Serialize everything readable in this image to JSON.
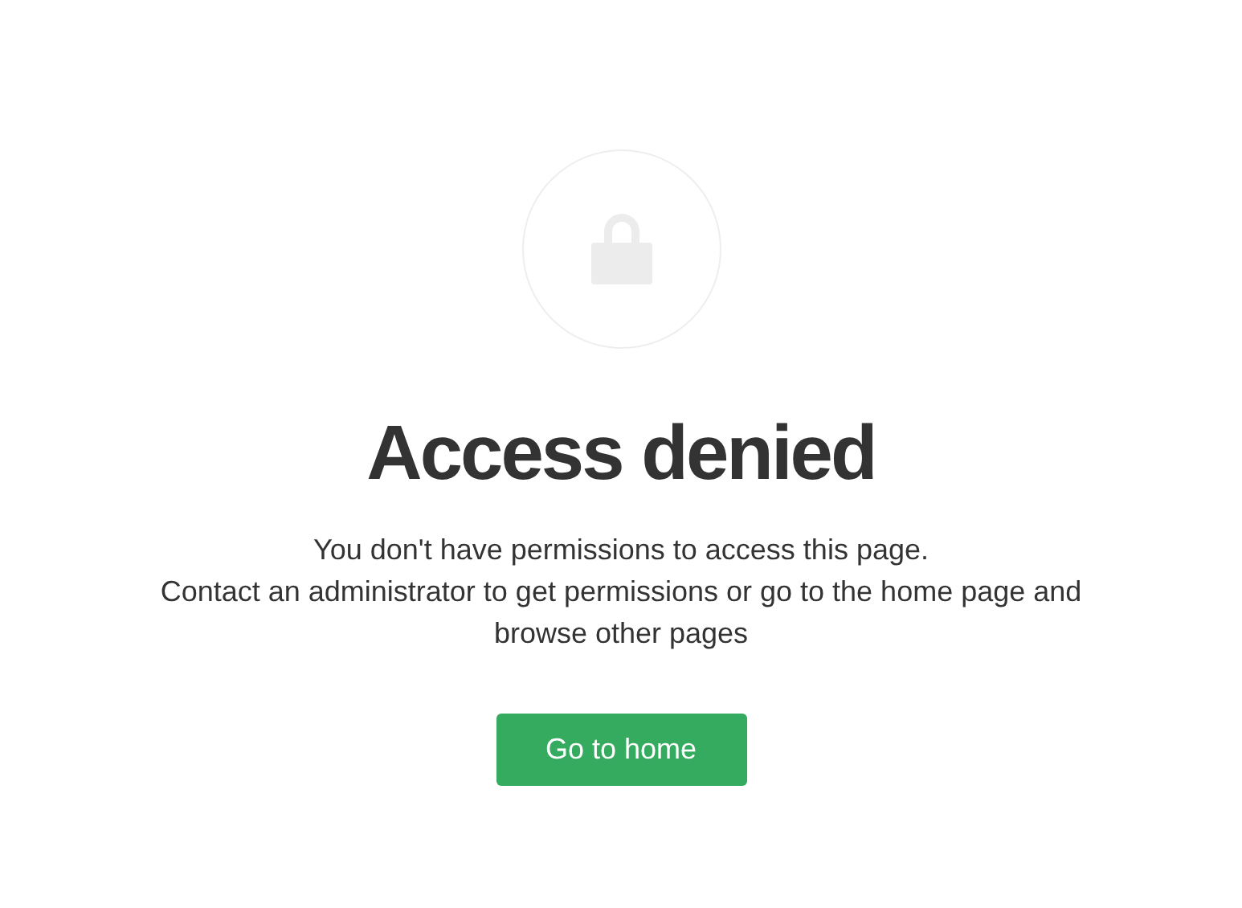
{
  "title": "Access denied",
  "message": [
    "You don't have permissions to access this page.",
    "Contact an administrator to get permissions or go to the home page and browse other pages"
  ],
  "button": "Go to home"
}
